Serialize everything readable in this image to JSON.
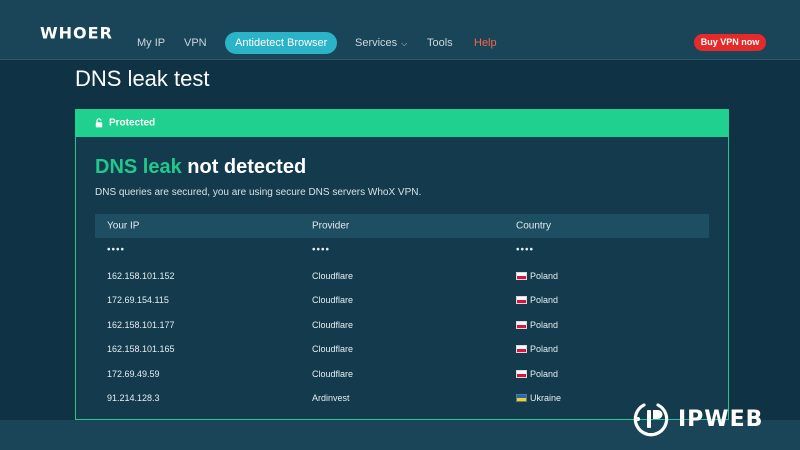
{
  "header": {
    "logo": "WHOER",
    "nav": [
      {
        "label": "My IP"
      },
      {
        "label": "VPN"
      },
      {
        "label": "Antidetect Browser"
      },
      {
        "label": "Services"
      },
      {
        "label": "Tools"
      },
      {
        "label": "Help"
      }
    ],
    "buy_label": "Buy VPN now"
  },
  "page": {
    "title": "DNS leak test"
  },
  "status": {
    "label": "Protected"
  },
  "result": {
    "headline_highlight": "DNS leak",
    "headline_rest": " not detected",
    "description": "DNS queries are secured, you are using secure DNS servers WhoX VPN."
  },
  "table": {
    "columns": [
      "Your IP",
      "Provider",
      "Country"
    ],
    "masked_row": [
      "••••",
      "••••",
      "••••"
    ],
    "rows": [
      {
        "ip": "162.158.101.152",
        "provider": "Cloudflare",
        "country": "Poland",
        "flag": "pl"
      },
      {
        "ip": "172.69.154.115",
        "provider": "Cloudflare",
        "country": "Poland",
        "flag": "pl"
      },
      {
        "ip": "162.158.101.177",
        "provider": "Cloudflare",
        "country": "Poland",
        "flag": "pl"
      },
      {
        "ip": "162.158.101.165",
        "provider": "Cloudflare",
        "country": "Poland",
        "flag": "pl"
      },
      {
        "ip": "172.69.49.59",
        "provider": "Cloudflare",
        "country": "Poland",
        "flag": "pl"
      },
      {
        "ip": "91.214.128.3",
        "provider": "Ardinvest",
        "country": "Ukraine",
        "flag": "ua"
      }
    ]
  },
  "watermark": {
    "text": "IPWEB"
  },
  "colors": {
    "accent_green": "#1fd08e",
    "nav_active": "#2bb3c8",
    "help": "#f0674c",
    "buy_button": "#e52a2a",
    "background": "#0f3344"
  },
  "icons": {
    "status": "lock-icon",
    "services": "chevron-down-icon",
    "watermark": "ipweb-logo-icon"
  }
}
